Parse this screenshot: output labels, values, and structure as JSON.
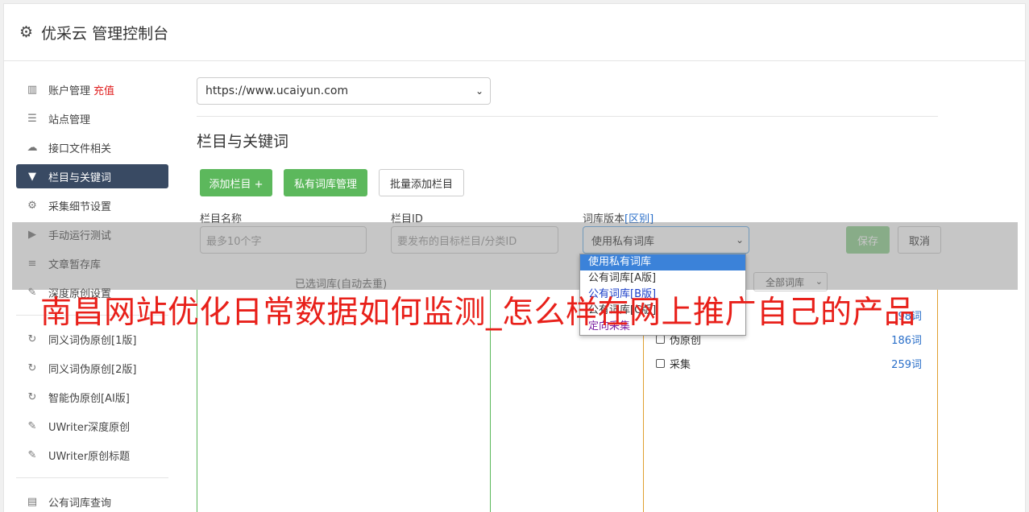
{
  "header": {
    "title": "优采云 管理控制台",
    "icon": "gear-icon"
  },
  "sidebar": {
    "items": [
      {
        "label": "账户管理",
        "badge": "充值",
        "icon": "bar-chart-icon"
      },
      {
        "label": "站点管理",
        "icon": "server-icon"
      },
      {
        "label": "接口文件相关",
        "icon": "cloud-upload-icon"
      },
      {
        "label": "栏目与关键词",
        "icon": "filter-icon",
        "active": true
      },
      {
        "label": "采集细节设置",
        "icon": "cogs-icon"
      },
      {
        "label": "手动运行测试",
        "icon": "play-icon"
      },
      {
        "label": "文章暂存库",
        "icon": "database-icon"
      },
      {
        "label": "深度原创设置",
        "icon": "edit-icon"
      }
    ],
    "group2": [
      {
        "label": "同义词伪原创[1版]",
        "icon": "refresh-icon"
      },
      {
        "label": "同义词伪原创[2版]",
        "icon": "refresh-icon"
      },
      {
        "label": "智能伪原创[AI版]",
        "icon": "refresh-icon"
      },
      {
        "label": "UWriter深度原创",
        "icon": "edit-icon"
      },
      {
        "label": "UWriter原创标题",
        "icon": "edit-icon"
      }
    ],
    "group3": [
      {
        "label": "公有词库查询",
        "icon": "book-icon"
      }
    ]
  },
  "main": {
    "site_select": "https://www.ucaiyun.com",
    "section_title": "栏目与关键词",
    "buttons": {
      "add": "添加栏目 +",
      "private_lib": "私有词库管理",
      "batch_add": "批量添加栏目",
      "save": "保存",
      "cancel": "取消"
    },
    "fields": {
      "name_label": "栏目名称",
      "name_placeholder": "最多10个字",
      "id_label": "栏目ID",
      "id_placeholder": "要发布的目标栏目/分类ID",
      "version_label": "词库版本",
      "version_link": "[区别]",
      "version_value": "使用私有词库"
    },
    "dropdown": [
      "使用私有词库",
      "公有词库[A版]",
      "公有词库[B版]",
      "公有词库[C版]",
      "定向采集"
    ],
    "selected_panel_label": "已选词库(自动去重)",
    "filter_select": "全部词库",
    "libs": [
      {
        "name": "",
        "count": "98词"
      },
      {
        "name": "伪原创",
        "count": "186词"
      },
      {
        "name": "采集",
        "count": "259词"
      }
    ]
  },
  "watermark": "南昌网站优化日常数据如何监测_怎么样在网上推广自己的产品"
}
